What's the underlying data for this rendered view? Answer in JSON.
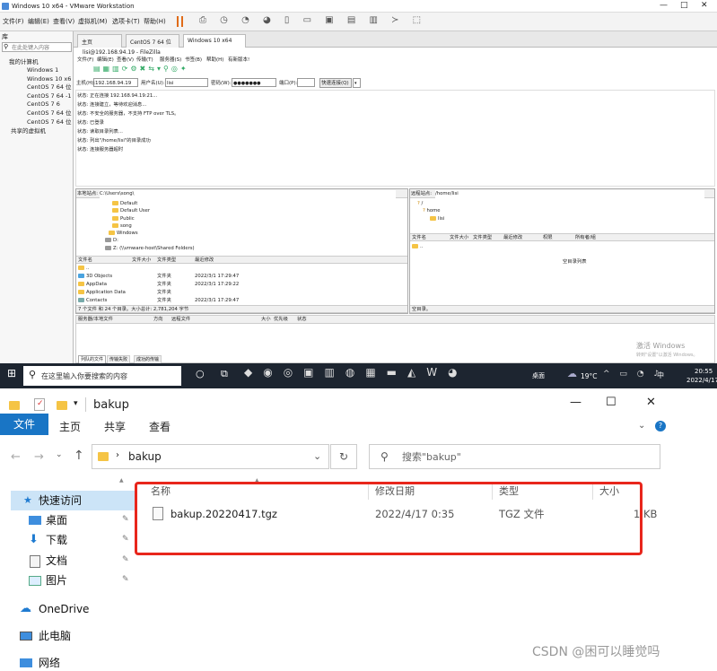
{
  "vmware": {
    "title": "Windows 10 x64 - VMware Workstation",
    "menu": [
      "文件(F)",
      "编辑(E)",
      "查看(V)",
      "虚拟机(M)",
      "选项卡(T)",
      "帮助(H)"
    ],
    "sidebar_title": "库",
    "search_placeholder": "在此处键入内容",
    "tree_root": "我的计算机",
    "vms": [
      "Windows 1",
      "Windows 10 x6",
      "CentOS 7 64 位",
      "CentOS 7 64 -1",
      "CentOS 7 6",
      "CentOS 7 64 位",
      "CentOS 7 64 位"
    ],
    "shared": "共享的虚拟机",
    "tabs": [
      "主页",
      "CentOS 7 64 位",
      "Windows 10 x64"
    ]
  },
  "filezilla": {
    "title": "lisi@192.168.94.19 - FileZilla",
    "menu": [
      "文件(F)",
      "编辑(E)",
      "查看(V)",
      "传输(T)",
      "服务器(S)",
      "书签(B)",
      "帮助(H)",
      "有新版本!"
    ],
    "host_label": "主机(H):",
    "host": "192.168.94.19",
    "user_label": "用户名(U):",
    "user": "lisi",
    "pass_label": "密码(W):",
    "pass": "●●●●●●●",
    "port_label": "端口(P):",
    "port": "",
    "connect": "快速连接(Q)",
    "log": [
      "状态:  正在连接 192.168.94.19:21...",
      "状态:  连接建立，等待欢迎消息...",
      "状态:  不安全的服务器，不支持 FTP over TLS。",
      "状态:  已登录",
      "状态:  读取目录列表...",
      "状态:  列出\"/home/lisi\"的目录成功",
      "状态:  连接服务器超时"
    ],
    "local_label": "本地站点:",
    "local_path": "C:\\Users\\song\\",
    "local_tree": [
      "Default",
      "Default User",
      "Public",
      "song",
      "Windows",
      "D:",
      "Z: (\\\\vmware-host\\Shared Folders)"
    ],
    "local_cols": [
      "文件名",
      "文件大小",
      "文件类型",
      "最近修改"
    ],
    "local_files": [
      {
        "name": "..",
        "type": "",
        "date": ""
      },
      {
        "name": "3D Objects",
        "type": "文件夹",
        "date": "2022/3/1 17:29:47"
      },
      {
        "name": "AppData",
        "type": "文件夹",
        "date": "2022/3/1 17:29:22"
      },
      {
        "name": "Application Data",
        "type": "文件夹",
        "date": ""
      },
      {
        "name": "Contacts",
        "type": "文件夹",
        "date": "2022/3/1 17:29:47"
      }
    ],
    "local_status": "7 个文件 和 24 个目录。大小总计: 2,781,204 字节",
    "remote_label": "远程站点:",
    "remote_path": "/home/lisi",
    "remote_tree": [
      "/",
      "home",
      "lisi"
    ],
    "remote_cols": [
      "文件名",
      "文件大小",
      "文件类型",
      "最近修改",
      "权限",
      "所有者/组"
    ],
    "remote_files": [
      ".."
    ],
    "remote_empty": "空目录列表",
    "remote_status": "空目录。",
    "queue_cols": [
      "服务器/本地文件",
      "方向",
      "远程文件",
      "大小",
      "优先级",
      "状态"
    ],
    "queue_tabs": [
      "列队的文件",
      "传输失败",
      "成功的传输"
    ],
    "activate": "激活 Windows",
    "activate_sub": "转到\"设置\"以激活 Windows。"
  },
  "taskbar": {
    "search_placeholder": "在这里输入你要搜索的内容",
    "desktop": "桌面",
    "temp": "19°C",
    "ime": "中",
    "time": "20:55",
    "date": "2022/4/17"
  },
  "explorer": {
    "title": "bakup",
    "ribbon": [
      "文件",
      "主页",
      "共享",
      "查看"
    ],
    "path": "bakup",
    "search_placeholder": "搜索\"bakup\"",
    "nav": [
      "快速访问",
      "桌面",
      "下载",
      "文档",
      "图片",
      "OneDrive",
      "此电脑",
      "网络"
    ],
    "cols": [
      "名称",
      "修改日期",
      "类型",
      "大小"
    ],
    "files": [
      {
        "name": "bakup.20220417.tgz",
        "date": "2022/4/17 0:35",
        "type": "TGZ 文件",
        "size": "1 KB"
      }
    ],
    "highlight_color": "#e8261c"
  },
  "watermark": "CSDN @困可以睡觉吗"
}
